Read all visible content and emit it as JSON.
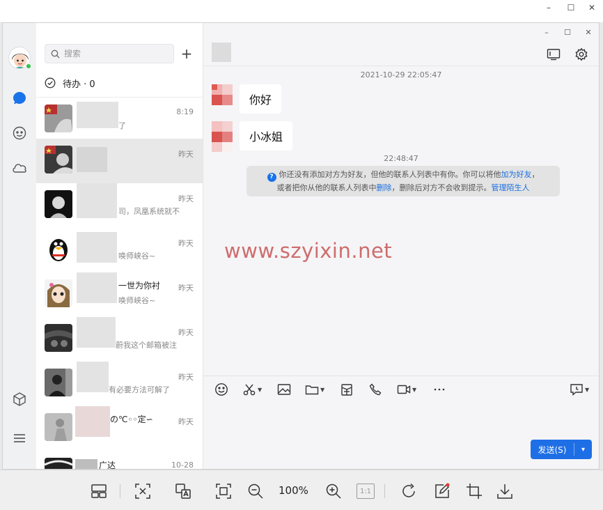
{
  "window": {
    "min": "–",
    "max": "☐",
    "close": "✕"
  },
  "qq_window": {
    "min": "–",
    "max": "☐",
    "close": "✕"
  },
  "search": {
    "placeholder": "搜索",
    "add_label": "+"
  },
  "todo": {
    "label": "待办 · 0"
  },
  "chat_list": [
    {
      "name": "",
      "msg": "了",
      "time": "8:19"
    },
    {
      "name": "",
      "msg": "",
      "time": "昨天"
    },
    {
      "name": "",
      "msg": "司，凤凰系统就不",
      "time": "昨天"
    },
    {
      "name": "",
      "msg": "唤师峡谷~",
      "time": "昨天"
    },
    {
      "name": "一世为你衬",
      "msg": "唤师峡谷~",
      "time": "昨天"
    },
    {
      "name": "",
      "msg": "蔚我这个邮箱被注",
      "time": "昨天"
    },
    {
      "name": "",
      "msg": "有必要方法可解了",
      "time": "昨天"
    },
    {
      "name": "の℃◦◦定∽",
      "msg": "",
      "time": "昨天"
    },
    {
      "name": "广达",
      "msg": "",
      "time": "10-28"
    }
  ],
  "chat": {
    "timestamp1": "2021-10-29 22:05:47",
    "messages": [
      "你好",
      "小冰姐"
    ],
    "timestamp2": "22:48:47",
    "notice_part1": "你还没有添加对方为好友，但他的联系人列表中有你。你可以将他",
    "notice_link1": "加为好友",
    "notice_part2": "，",
    "notice_part3": "或者把你从他的联系人列表中",
    "notice_link2": "删除",
    "notice_part4": "，删除后对方不会收到提示。",
    "notice_link3": "管理陌生人"
  },
  "watermark": "www.szyixin.net",
  "composer": {
    "send_label": "发送(S)",
    "send_dropdown": "▾"
  },
  "viewer": {
    "zoom": "100%",
    "one_to_one": "1:1"
  },
  "colors": {
    "accent": "#1e6fe6",
    "link": "#1a6ee0",
    "watermark": "#c03838",
    "online": "#2ec44a"
  }
}
